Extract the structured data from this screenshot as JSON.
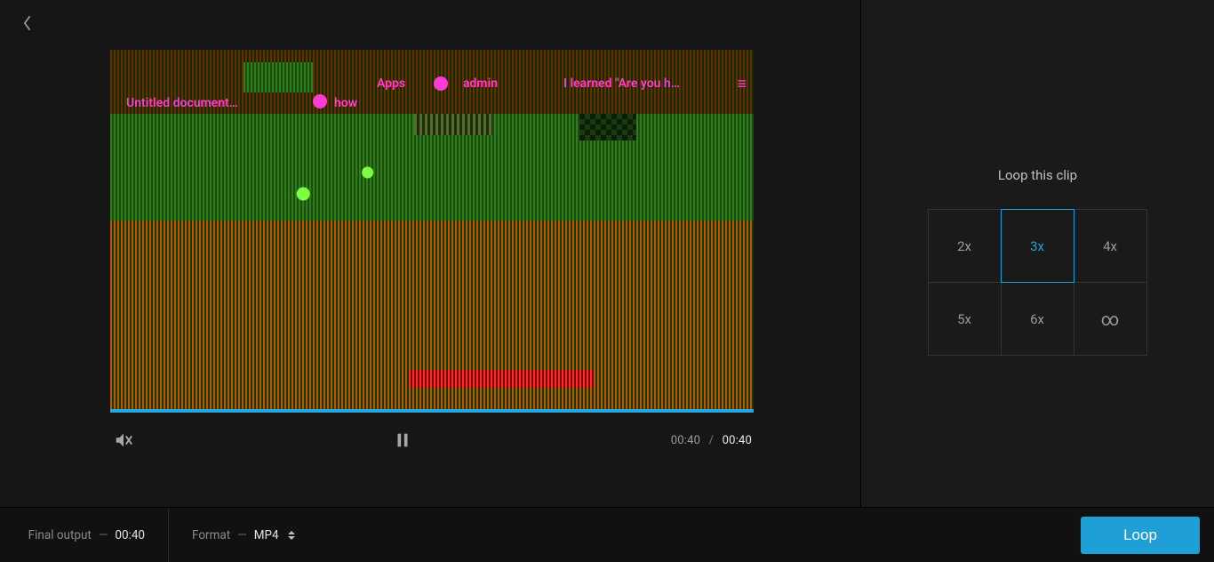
{
  "back_label": "Back",
  "preview": {
    "overlay": {
      "apps": "Apps",
      "admin": "admin",
      "learned": "I learned \"Are you h…",
      "untitled": "Untitled document…",
      "how": "how",
      "hamburger": "≡"
    },
    "time": {
      "current": "00:40",
      "separator": "/",
      "duration": "00:40"
    },
    "mute_icon_name": "volume-muted-icon",
    "pause_icon_name": "pause-icon"
  },
  "side": {
    "title": "Loop this clip",
    "options": [
      {
        "label": "2x",
        "selected": false
      },
      {
        "label": "3x",
        "selected": true
      },
      {
        "label": "4x",
        "selected": false
      },
      {
        "label": "5x",
        "selected": false
      },
      {
        "label": "6x",
        "selected": false
      },
      {
        "label": "∞",
        "selected": false,
        "is_infinite": true
      }
    ]
  },
  "bottom": {
    "final_output_label": "Final output",
    "final_output_value": "00:40",
    "format_label": "Format",
    "format_value": "MP4",
    "loop_button": "Loop"
  }
}
